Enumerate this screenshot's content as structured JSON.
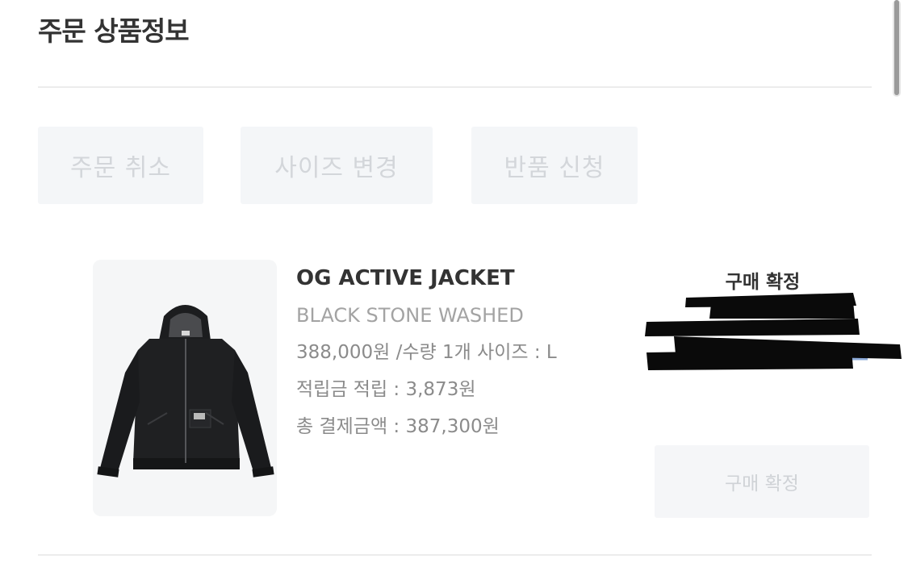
{
  "section": {
    "title": "주문 상품정보"
  },
  "actions": {
    "cancel_label": "주문 취소",
    "size_change_label": "사이즈 변경",
    "return_label": "반품 신청"
  },
  "product": {
    "image_icon": "jacket-image",
    "name": "OG ACTIVE JACKET",
    "color": "BLACK STONE WASHED",
    "price_line": "388,000원 /수량 1개 사이즈 : L",
    "points_line": "적립금 적립 : 3,873원",
    "total_line": "총 결제금액 : 387,300원"
  },
  "status": {
    "label": "구매 확정",
    "confirm_button_label": "구매 확정"
  },
  "colors": {
    "text_primary": "#333333",
    "text_muted": "#8b8b8b",
    "button_disabled_bg": "#f4f6f8",
    "button_disabled_text": "#d3d6da",
    "redaction": "#0a0a0a"
  }
}
